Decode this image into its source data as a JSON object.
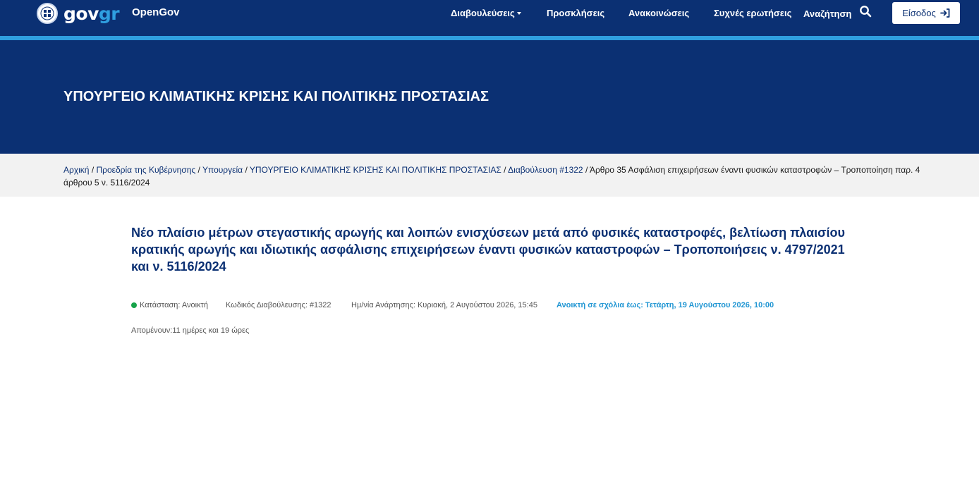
{
  "header": {
    "logo_text_main": "gov",
    "logo_text_accent": "gr",
    "app_name": "OpenGov",
    "nav": {
      "consultations": "Διαβουλεύσεις",
      "calls": "Προσκλήσεις",
      "announcements": "Ανακοινώσεις",
      "faq": "Συχνές ερωτήσεις",
      "search": "Αναζήτηση"
    },
    "login_label": "Είσοδος"
  },
  "hero": {
    "title": "ΥΠΟΥΡΓΕΙΟ ΚΛΙΜΑΤΙΚΗΣ ΚΡΙΣΗΣ ΚΑΙ ΠΟΛΙΤΙΚΗΣ ΠΡΟΣΤΑΣΙΑΣ"
  },
  "breadcrumb": {
    "home": "Αρχική",
    "presidency": "Προεδρία της Κυβέρνησης",
    "ministries": "Υπουργεία",
    "ministry": "ΥΠΟΥΡΓΕΙΟ ΚΛΙΜΑΤΙΚΗΣ ΚΡΙΣΗΣ ΚΑΙ ΠΟΛΙΤΙΚΗΣ ΠΡΟΣΤΑΣΙΑΣ",
    "consultation": "Διαβούλευση #1322",
    "current": "Άρθρο 35 Ασφάλιση επιχειρήσεων έναντι φυσικών καταστροφών – Τροποποίηση παρ. 4 άρθρου 5 ν. 5116/2024",
    "separator": "/"
  },
  "article": {
    "title": "Νέο πλαίσιο μέτρων στεγαστικής αρωγής και λοιπών ενισχύσεων μετά από φυσικές καταστροφές, βελτίωση πλαισίου κρατικής αρωγής και ιδιωτικής ασφάλισης επιχειρήσεων έναντι φυσικών καταστροφών – Τροποποιήσεις ν. 4797/2021 και ν. 5116/2024",
    "status": "Κατάσταση: Ανοικτή",
    "code": "Κωδικός Διαβούλευσης: #1322",
    "posted": "Ημ/νία Ανάρτησης: Κυριακή, 2 Αυγούστου 2026, 15:45",
    "open_until": "Ανοικτή σε σχόλια έως: Τετάρτη, 19 Αυγούστου 2026, 10:00",
    "remaining": "Απομένουν:11 ημέρες και 19 ώρες"
  },
  "colors": {
    "brand_navy": "#0b3073",
    "accent_blue": "#2f9fe0",
    "status_green": "#16a34a",
    "open_until_blue": "#2196d3"
  },
  "icons": {
    "emblem": "greek-emblem-icon",
    "search": "search-icon",
    "login": "sign-in-icon",
    "caret": "caret-down-icon"
  }
}
